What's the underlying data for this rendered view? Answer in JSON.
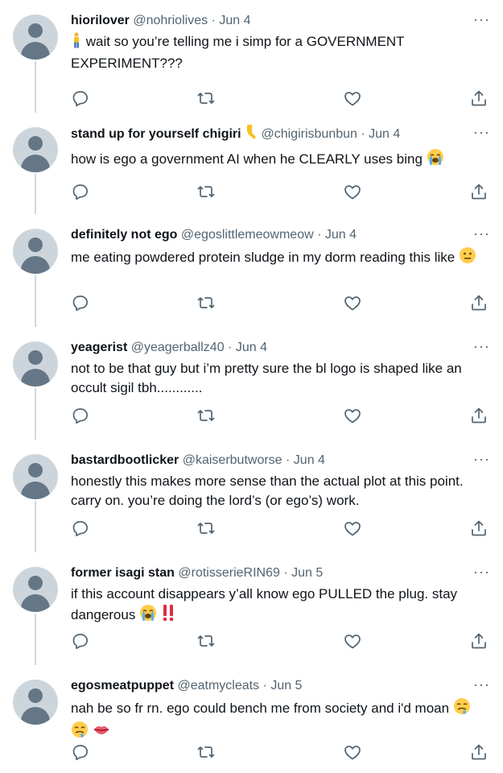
{
  "tweets": [
    {
      "display_name": "hiorilover",
      "handle": "@nohriolives",
      "sep": "·",
      "date": "Jun 4",
      "prefix_emoji": "person",
      "text": "wait so you’re telling me i simp for a GOVERNMENT EXPERIMENT???",
      "suffix_emojis": []
    },
    {
      "display_name": "stand up for yourself chigiri",
      "name_emoji": "leg",
      "handle": "@chigirisbunbun",
      "sep": "·",
      "date": "Jun 4",
      "text": "how is ego a government AI when he CLEARLY uses bing",
      "suffix_emojis": [
        "loudly-crying-face"
      ]
    },
    {
      "display_name": "definitely not ego",
      "handle": "@egoslittlemeowmeow",
      "sep": "·",
      "date": "Jun 4",
      "text": "me eating powdered protein sludge in my dorm reading this like",
      "suffix_emojis": [
        "neutral-face"
      ]
    },
    {
      "display_name": "yeagerist",
      "handle": "@yeagerballz40",
      "sep": "·",
      "date": "Jun 4",
      "text": "not to be that guy but i’m pretty sure the bl logo is shaped like an occult sigil tbh............",
      "suffix_emojis": []
    },
    {
      "display_name": "bastardbootlicker",
      "handle": "@kaiserbutworse",
      "sep": "·",
      "date": "Jun 4",
      "text": "honestly this makes more sense than the actual plot at this point. carry on. you’re doing the lord’s (or ego’s) work.",
      "suffix_emojis": []
    },
    {
      "display_name": "former isagi stan",
      "handle": "@rotisserieRIN69",
      "sep": "·",
      "date": "Jun 5",
      "text": "if this account disappears y’all know ego PULLED the plug. stay dangerous",
      "suffix_emojis": [
        "loudly-crying-face",
        "double-exclamation"
      ]
    },
    {
      "display_name": "egosmeatpuppet",
      "handle": "@eatmycleats",
      "sep": "·",
      "date": "Jun 5",
      "text": "nah be so fr rn. ego could bench me from society and i'd moan",
      "suffix_emojis": [
        "drooling-face",
        "drooling-face",
        "lips"
      ]
    }
  ],
  "actions": [
    "reply-icon",
    "retweet-icon",
    "like-icon",
    "share-icon"
  ],
  "more_label": "···",
  "colors": {
    "text": "#0f1419",
    "muted": "#536471",
    "thread": "#cfd9de",
    "avatar_bg": "#cdd5dc",
    "avatar_fg": "#657786"
  }
}
